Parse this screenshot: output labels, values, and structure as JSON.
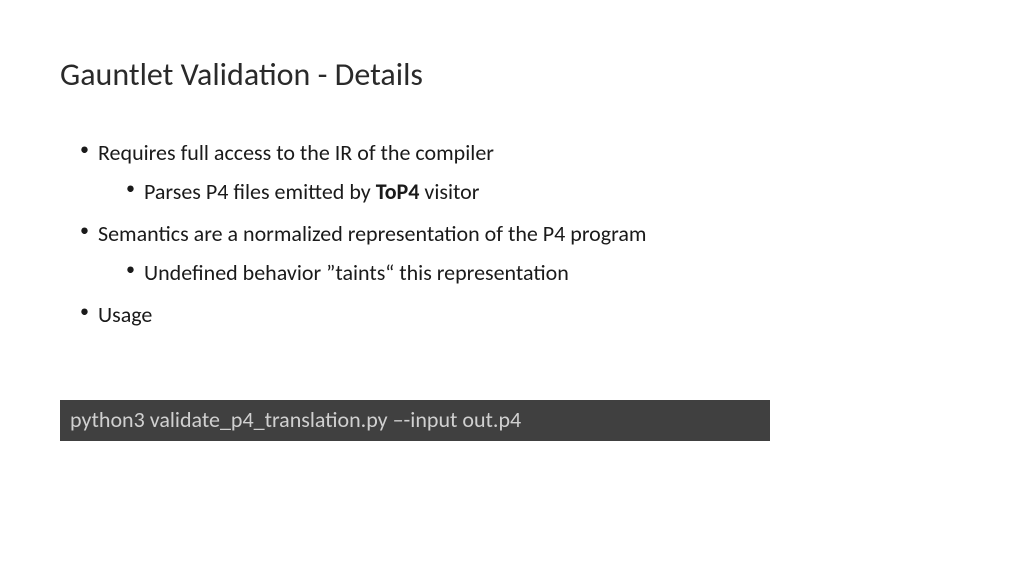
{
  "title": "Gauntlet Validation - Details",
  "bullets": {
    "b1": "Requires full access to the IR of the compiler",
    "b1_sub_pre": "Parses P4 files emitted by ",
    "b1_sub_bold": "ToP4",
    "b1_sub_post": " visitor",
    "b2": "Semantics are a normalized representation of the P4 program",
    "b2_sub": "Undefined behavior ”taints“ this representation",
    "b3": "Usage"
  },
  "code": "python3 validate_p4_translation.py –-input out.p4"
}
